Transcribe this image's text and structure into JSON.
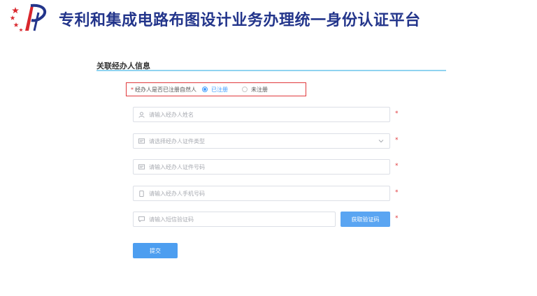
{
  "site": {
    "title": "专利和集成电路布图设计业务办理统一身份认证平台"
  },
  "section": {
    "title": "关联经办人信息"
  },
  "registered": {
    "label": "经办人是否已注册自然人",
    "options": [
      {
        "label": "已注册",
        "checked": true
      },
      {
        "label": "未注册",
        "checked": false
      }
    ]
  },
  "form": {
    "name_placeholder": "请输入经办人姓名",
    "id_type_placeholder": "请选择经办人证件类型",
    "id_number_placeholder": "请输入经办人证件号码",
    "phone_placeholder": "请输入经办人手机号码",
    "sms_placeholder": "请输入短信验证码",
    "required_mark": "*"
  },
  "buttons": {
    "get_code": "获取验证码",
    "submit": "提交"
  },
  "colors": {
    "brand": "#23358b",
    "primary": "#409eff",
    "required": "#e0393c",
    "underline": "#8fd3f0"
  },
  "icons": {
    "logo": "patent-logo-icon",
    "user": "user-icon",
    "card": "card-icon",
    "phone": "phone-icon",
    "message": "message-icon",
    "chevron": "chevron-down-icon"
  }
}
